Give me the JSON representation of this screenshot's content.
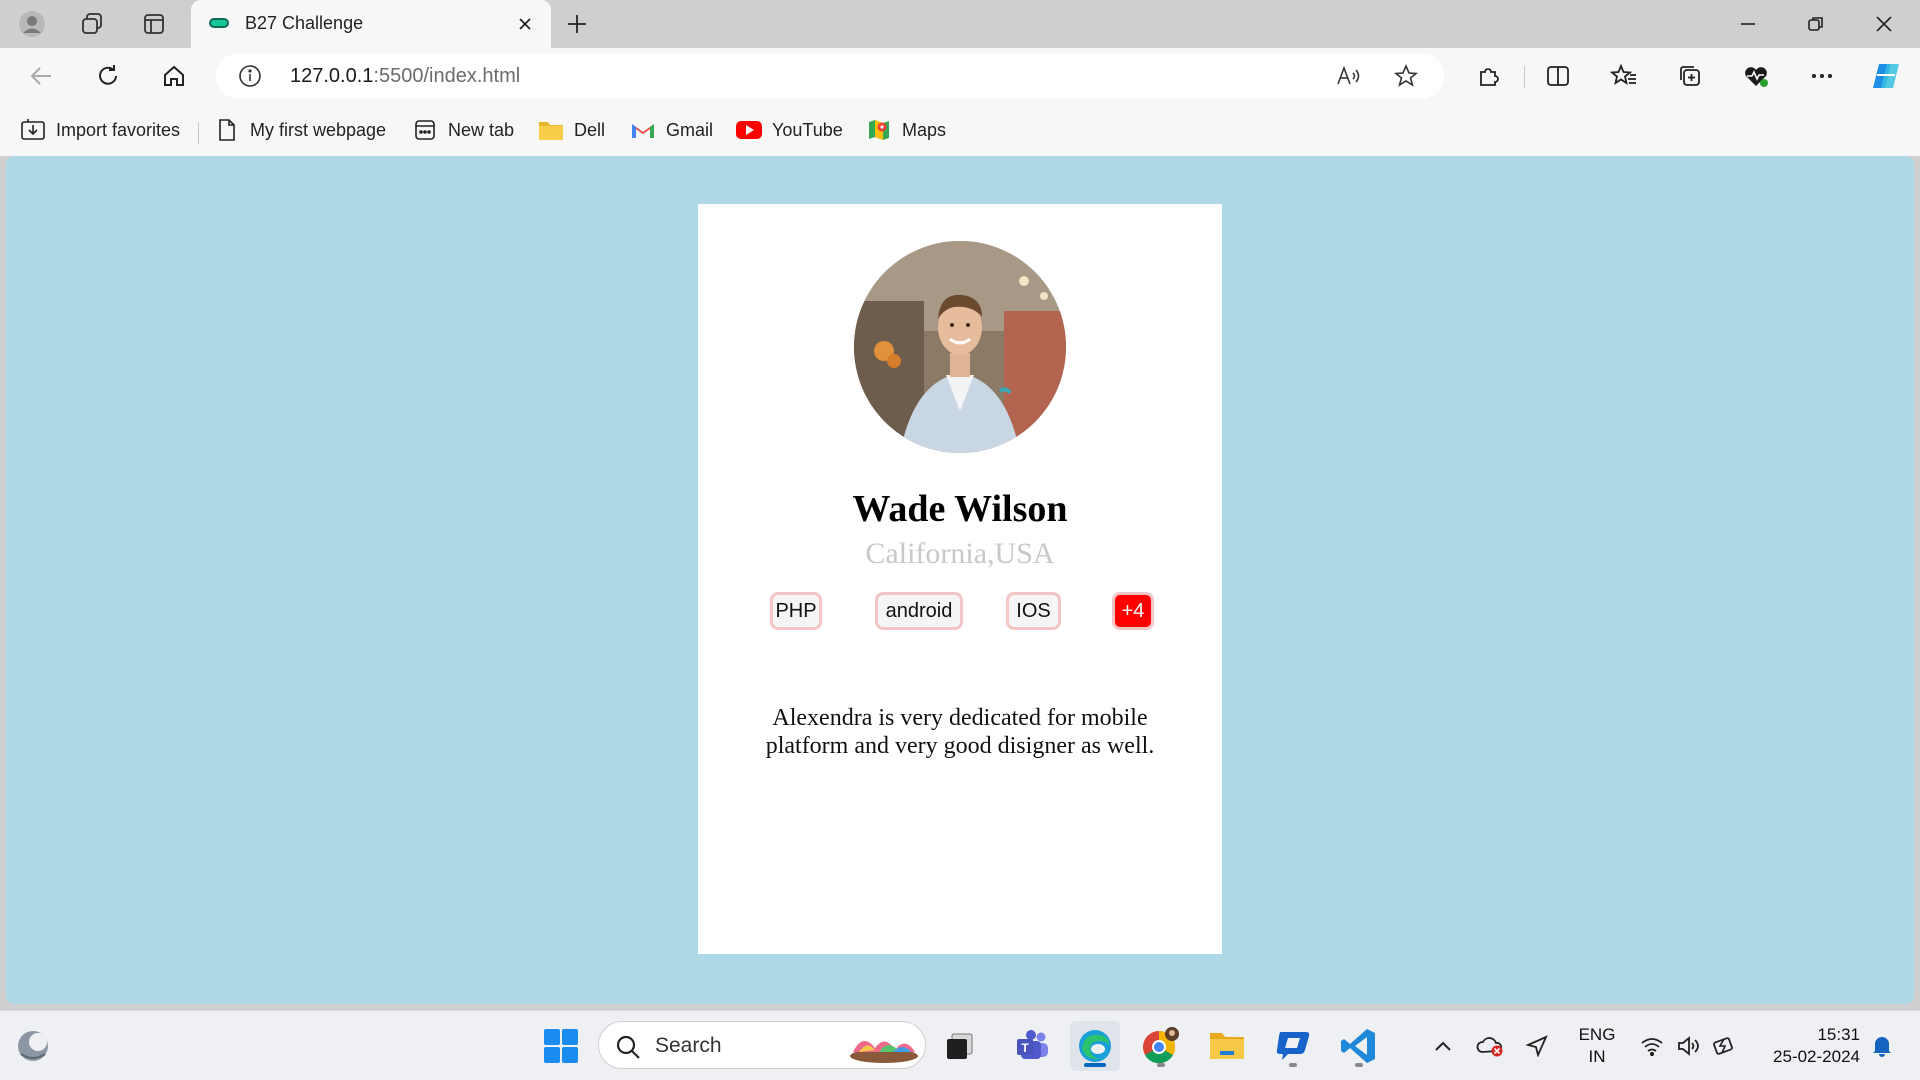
{
  "browser": {
    "tab_title": "B27 Challenge",
    "url_host": "127.0.0.1",
    "url_rest": ":5500/index.html"
  },
  "bookmarks": [
    {
      "label": "Import favorites",
      "icon": "import-icon"
    },
    {
      "label": "My first webpage",
      "icon": "page-icon"
    },
    {
      "label": "New tab",
      "icon": "newtab-icon"
    },
    {
      "label": "Dell",
      "icon": "folder-icon"
    },
    {
      "label": "Gmail",
      "icon": "gmail-icon"
    },
    {
      "label": "YouTube",
      "icon": "youtube-icon"
    },
    {
      "label": "Maps",
      "icon": "maps-icon"
    }
  ],
  "profile": {
    "name": "Wade Wilson",
    "location": "California,USA",
    "skills": [
      "PHP",
      "android",
      "IOS"
    ],
    "more_skills": "+4",
    "bio": "Alexendra is very dedicated for mobile platform and very good disigner as well."
  },
  "taskbar": {
    "search_placeholder": "Search",
    "lang_primary": "ENG",
    "lang_secondary": "IN",
    "time": "15:31",
    "date": "25-02-2024"
  },
  "colors": {
    "page_background": "#add8e6",
    "card_background": "#ffffff",
    "more_badge": "#ff0000",
    "skill_border": "#f3c5c5"
  }
}
